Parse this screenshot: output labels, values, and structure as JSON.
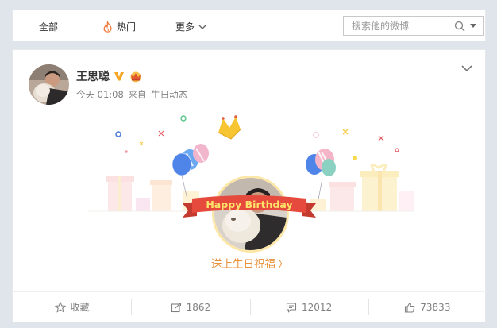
{
  "nav": {
    "all_label": "全部",
    "hot_label": "热门",
    "more_label": "更多",
    "search_placeholder": "搜索他的微博"
  },
  "post": {
    "author": "王思聪",
    "time": "今天 01:08",
    "source_prefix": "来自",
    "source": "生日动态",
    "banner_text": "Happy Birthday",
    "wish_link": "送上生日祝福"
  },
  "actions": {
    "favorite_label": "收藏",
    "repost_count": "1862",
    "comment_count": "12012",
    "like_count": "73833"
  },
  "colors": {
    "accent": "#e8913a",
    "ribbon": "#e64a3c",
    "verified": "#f5a623"
  }
}
